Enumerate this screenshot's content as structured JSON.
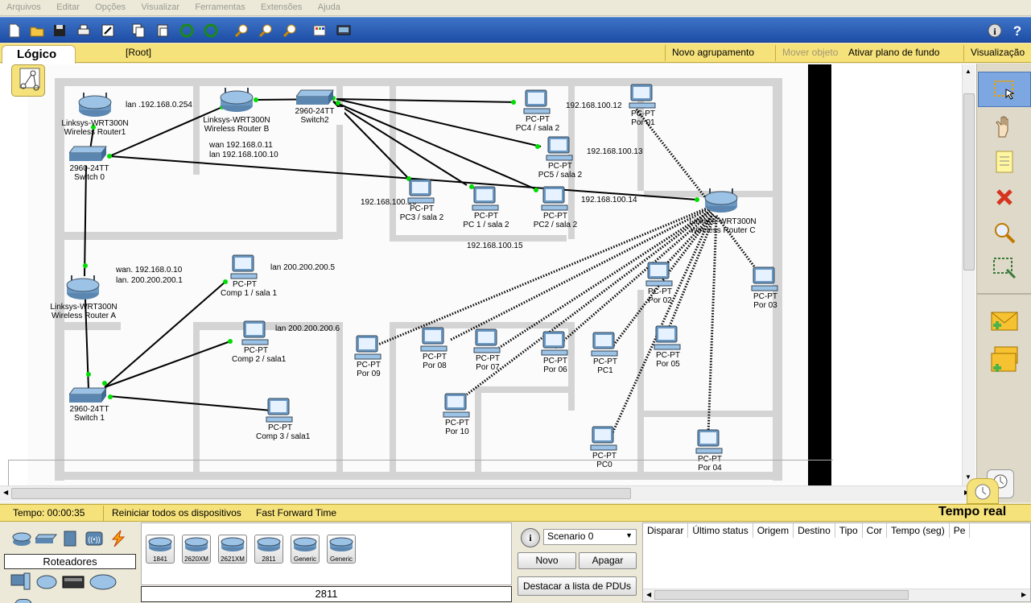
{
  "menu": [
    "Arquivos",
    "Editar",
    "Opções",
    "Visualizar",
    "Ferramentas",
    "Extensões",
    "Ajuda"
  ],
  "logical_bar": {
    "tab": "Lógico",
    "path": "[Root]",
    "new_cluster": "Novo agrupamento",
    "move_object": "Mover objeto",
    "set_background": "Ativar plano de fundo",
    "viewport": "Visualização"
  },
  "devices": {
    "router1": {
      "type": "Linksys-WRT300N",
      "name": "Wireless Router1"
    },
    "routerB": {
      "type": "Linksys-WRT300N",
      "name": "Wireless Router B"
    },
    "routerA": {
      "type": "Linksys-WRT300N",
      "name": "Wireless Router A"
    },
    "routerC": {
      "type": "Linksys-WRT300N",
      "name": "Wireless Router C"
    },
    "switch0": {
      "type": "2960-24TT",
      "name": "Switch 0"
    },
    "switch1": {
      "type": "2960-24TT",
      "name": "Switch 1"
    },
    "switch2": {
      "type": "2960-24TT",
      "name": "Switch2"
    },
    "pcs": [
      {
        "id": "pc4",
        "type": "PC-PT",
        "name": "PC4 / sala 2"
      },
      {
        "id": "pc5",
        "type": "PC-PT",
        "name": "PC5 / sala 2"
      },
      {
        "id": "pc3",
        "type": "PC-PT",
        "name": "PC3 / sala 2"
      },
      {
        "id": "pc1s2",
        "type": "PC-PT",
        "name": "PC 1 / sala 2"
      },
      {
        "id": "pc2",
        "type": "PC-PT",
        "name": "PC2 / sala 2"
      },
      {
        "id": "por01",
        "type": "PC-PT",
        "name": "Por 01"
      },
      {
        "id": "por02",
        "type": "PC-PT",
        "name": "Por 02"
      },
      {
        "id": "por03",
        "type": "PC-PT",
        "name": "Por 03"
      },
      {
        "id": "por05",
        "type": "PC-PT",
        "name": "Por 05"
      },
      {
        "id": "por06",
        "type": "PC-PT",
        "name": "Por 06"
      },
      {
        "id": "pc1",
        "type": "PC-PT",
        "name": "PC1"
      },
      {
        "id": "por07",
        "type": "PC-PT",
        "name": "Por 07"
      },
      {
        "id": "por08",
        "type": "PC-PT",
        "name": "Por 08"
      },
      {
        "id": "por09",
        "type": "PC-PT",
        "name": "Por 09"
      },
      {
        "id": "por10",
        "type": "PC-PT",
        "name": "Por 10"
      },
      {
        "id": "pc0",
        "type": "PC-PT",
        "name": "PC0"
      },
      {
        "id": "por04",
        "type": "PC-PT",
        "name": "Por 04"
      },
      {
        "id": "comp1",
        "type": "PC-PT",
        "name": "Comp 1 / sala 1"
      },
      {
        "id": "comp2",
        "type": "PC-PT",
        "name": "Comp 2 / sala1"
      },
      {
        "id": "comp3",
        "type": "PC-PT",
        "name": "Comp 3 / sala1"
      }
    ]
  },
  "annotations": {
    "lan1": "lan .192.168.0.254",
    "wanB": "wan 192.168.0.11",
    "lanB": "lan 192.168.100.10",
    "wanA": "wan. 192.168.0.10",
    "lanA": "lan. 200.200.200.1",
    "lanComp1": "lan 200.200.200.5",
    "lanComp2": "lan 200.200.200.6",
    "ip12": "192.168.100.12",
    "ip13": "192.168.100.13",
    "ip14": "192.168.100.14",
    "ip15": "192.168.100.15",
    "ip16": "192.168.100.16"
  },
  "status": {
    "time": "Tempo: 00:00:35",
    "reset": "Reiniciar todos os dispositivos",
    "fast_forward": "Fast Forward Time",
    "mode": "Tempo real"
  },
  "device_panel": {
    "category": "Roteadores",
    "models": [
      "1841",
      "2620XM",
      "2621XM",
      "2811",
      "Generic",
      "Generic"
    ],
    "selected_model": "2811"
  },
  "scenario": {
    "selected": "Scenario 0",
    "new": "Novo",
    "delete": "Apagar",
    "toggle_pdu": "Destacar a lista de PDUs"
  },
  "pdu_columns": [
    "Disparar",
    "Último status",
    "Origem",
    "Destino",
    "Tipo",
    "Cor",
    "Tempo (seg)",
    "Pe"
  ],
  "colors": {
    "accent_yellow": "#f6e27a",
    "toolbar_blue": "#2a5db8",
    "link_green": "#00dd00"
  }
}
